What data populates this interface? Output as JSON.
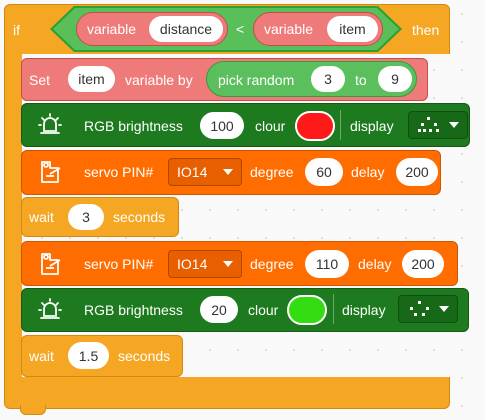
{
  "if_block": {
    "if_label": "if",
    "then_label": "then",
    "condition": {
      "left_keyword": "variable",
      "left_name": "distance",
      "operator": "<",
      "right_keyword": "variable",
      "right_name": "item"
    }
  },
  "set_block": {
    "label": "Set",
    "variable_name": "item",
    "middle_label": "variable by",
    "random_label": "pick random",
    "random_from": "3",
    "to_label": "to",
    "random_to": "9"
  },
  "rgb1": {
    "label": "RGB brightness",
    "brightness": "100",
    "colour_label": "clour",
    "colour": "#ff1a1a",
    "display_label": "display",
    "display_icon": "sad-face-matrix"
  },
  "servo1": {
    "label": "servo PIN#",
    "pin": "IO14",
    "degree_label": "degree",
    "degree": "60",
    "delay_label": "delay",
    "delay": "200"
  },
  "wait1": {
    "label": "wait",
    "value": "3",
    "unit": "seconds"
  },
  "servo2": {
    "label": "servo PIN#",
    "pin": "IO14",
    "degree_label": "degree",
    "degree": "110",
    "delay_label": "delay",
    "delay": "200"
  },
  "rgb2": {
    "label": "RGB brightness",
    "brightness": "20",
    "colour_label": "clour",
    "colour": "#33dd11",
    "display_label": "display",
    "display_icon": "smile-face-matrix"
  },
  "wait2": {
    "label": "wait",
    "value": "1.5",
    "unit": "seconds"
  },
  "colors": {
    "control": "#f5a623",
    "operator": "#59c059",
    "variable": "#ef7a7a",
    "rgb": "#1e7a1e",
    "servo": "#ff6d00"
  }
}
